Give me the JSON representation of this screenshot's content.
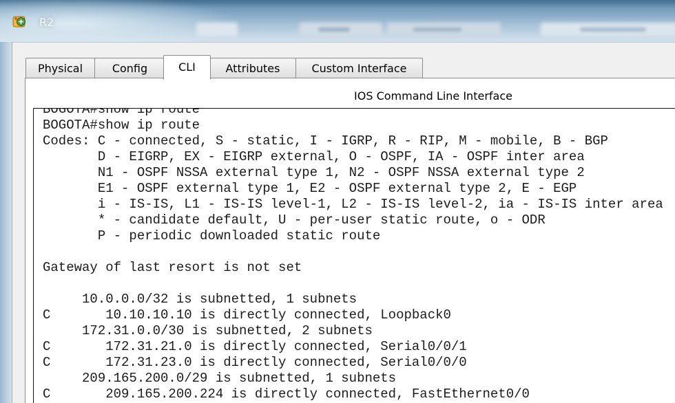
{
  "window": {
    "title": "R2",
    "icon": "packet-tracer-device-icon"
  },
  "tabs": [
    {
      "label": "Physical",
      "selected": false
    },
    {
      "label": "Config",
      "selected": false
    },
    {
      "label": "CLI",
      "selected": true
    },
    {
      "label": "Attributes",
      "selected": false
    },
    {
      "label": "Custom Interface",
      "selected": false
    }
  ],
  "cli": {
    "heading": "IOS Command Line Interface",
    "lines": [
      "BOGOTA#show ip route",
      "BOGOTA#show ip route",
      "Codes: C - connected, S - static, I - IGRP, R - RIP, M - mobile, B - BGP",
      "       D - EIGRP, EX - EIGRP external, O - OSPF, IA - OSPF inter area",
      "       N1 - OSPF NSSA external type 1, N2 - OSPF NSSA external type 2",
      "       E1 - OSPF external type 1, E2 - OSPF external type 2, E - EGP",
      "       i - IS-IS, L1 - IS-IS level-1, L2 - IS-IS level-2, ia - IS-IS inter area",
      "       * - candidate default, U - per-user static route, o - ODR",
      "       P - periodic downloaded static route",
      "",
      "Gateway of last resort is not set",
      "",
      "     10.0.0.0/32 is subnetted, 1 subnets",
      "C       10.10.10.10 is directly connected, Loopback0",
      "     172.31.0.0/30 is subnetted, 2 subnets",
      "C       172.31.21.0 is directly connected, Serial0/0/1",
      "C       172.31.23.0 is directly connected, Serial0/0/0",
      "     209.165.200.0/29 is subnetted, 1 subnets",
      "C       209.165.200.224 is directly connected, FastEthernet0/0"
    ]
  },
  "colors": {
    "title_bar_glass": "#86acc9",
    "tab_border": "#898c95",
    "window_background": "#f0f0f0",
    "terminal_background": "#ffffff",
    "terminal_text": "#000000"
  }
}
